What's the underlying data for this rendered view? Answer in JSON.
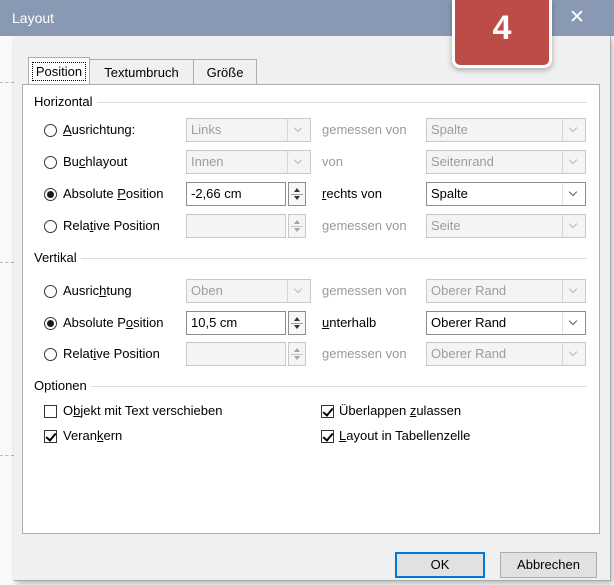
{
  "dialog": {
    "title": "Layout",
    "step_badge": "4",
    "close_glyph": "✕"
  },
  "tabs": [
    "Position",
    "Textumbruch",
    "Größe"
  ],
  "horizontal": {
    "title": "Horizontal",
    "rows": [
      {
        "label": "Ausrichtung:",
        "selected": false,
        "value": "Links",
        "relation": "gemessen von",
        "reference": "Spalte",
        "enabled": false
      },
      {
        "label": "Buchlayout",
        "selected": false,
        "value": "Innen",
        "relation": "von",
        "reference": "Seitenrand",
        "enabled": false
      },
      {
        "label": "Absolute Position",
        "selected": true,
        "value": "-2,66 cm",
        "relation": "rechts von",
        "reference": "Spalte",
        "enabled": true
      },
      {
        "label": "Relative Position",
        "selected": false,
        "value": "",
        "relation": "gemessen von",
        "reference": "Seite",
        "enabled": false
      }
    ]
  },
  "vertical": {
    "title": "Vertikal",
    "rows": [
      {
        "label": "Ausrichtung",
        "selected": false,
        "value": "Oben",
        "relation": "gemessen von",
        "reference": "Oberer Rand",
        "enabled": false
      },
      {
        "label": "Absolute Position",
        "selected": true,
        "value": "10,5 cm",
        "relation": "unterhalb",
        "reference": "Oberer Rand",
        "enabled": true
      },
      {
        "label": "Relative Position",
        "selected": false,
        "value": "",
        "relation": "gemessen von",
        "reference": "Oberer Rand",
        "enabled": false
      }
    ]
  },
  "options": {
    "title": "Optionen",
    "items": [
      {
        "label": "Objekt mit Text verschieben",
        "checked": false
      },
      {
        "label": "Verankern",
        "checked": true
      },
      {
        "label": "Überlappen zulassen",
        "checked": true
      },
      {
        "label": "Layout in Tabellenzelle",
        "checked": true
      }
    ]
  },
  "buttons": {
    "ok": "OK",
    "cancel": "Abbrechen"
  }
}
